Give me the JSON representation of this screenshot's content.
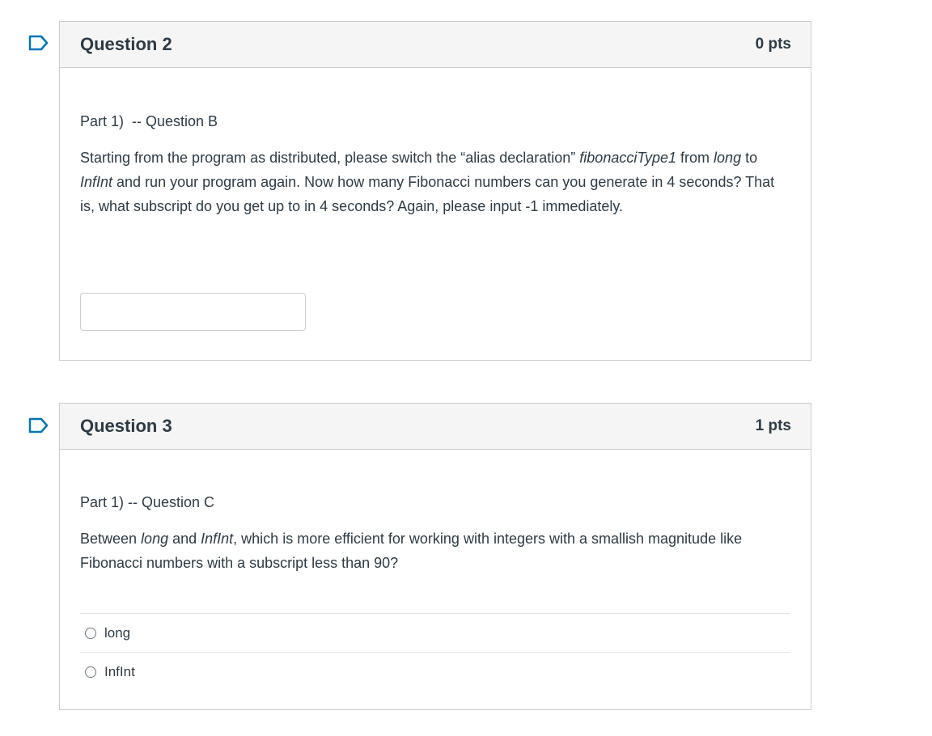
{
  "questions": [
    {
      "title": "Question 2",
      "points": "0 pts",
      "part_label": "Part 1)  -- Question B",
      "text_1": "Starting from the program as distributed, please switch the “alias declaration” ",
      "em_1": "fibonacciType1",
      "text_2": " from ",
      "em_2": "long",
      "text_3": " to ",
      "em_3": "InfInt",
      "text_4": " and run your program again.  Now how many Fibonacci numbers can you generate in 4 seconds?  That is, what subscript do you get up to in 4 seconds?  Again, please input -1 immediately.",
      "answer_value": ""
    },
    {
      "title": "Question 3",
      "points": "1 pts",
      "part_label": "Part 1) -- Question C",
      "text_1": "Between ",
      "em_1": "long",
      "text_2": " and ",
      "em_2": "InfInt",
      "text_3": ", which is more efficient for working with integers with a smallish magnitude like Fibonacci numbers with a subscript less than 90?",
      "options": [
        "long",
        "InfInt"
      ]
    }
  ],
  "colors": {
    "flag": "#0374b5",
    "header_bg": "#f5f5f5",
    "border": "#c7cdd1",
    "text": "#2d3b45"
  },
  "icons": {
    "flag": "bookmark-flag-icon",
    "radio": "radio-button-icon"
  }
}
